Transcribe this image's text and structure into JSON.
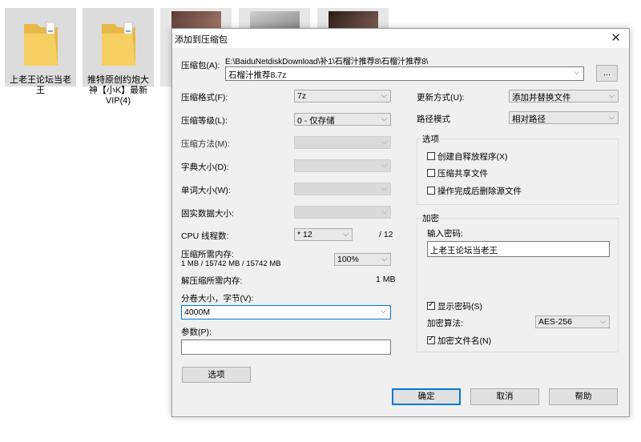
{
  "desktop": {
    "items": [
      {
        "label": "上老王论坛当老王",
        "icon": "folder-icon"
      },
      {
        "label": "推特原创约炮大神【小K】最新VIP(4)",
        "icon": "folder-icon"
      }
    ],
    "thumb_icons": [
      "image-thumbnail-icon",
      "image-thumbnail-icon",
      "image-thumbnail-icon"
    ]
  },
  "dialog": {
    "title": "添加到压缩包",
    "close_glyph": "✕",
    "archive": {
      "label": "压缩包(A):",
      "path": "E:\\BaiduNetdiskDownload\\补1\\石榴汁推荐8\\石榴汁推荐8\\",
      "value": "石榴汁推荐8.7z",
      "browse_label": "..."
    },
    "left": {
      "format": {
        "label": "压缩格式(F):",
        "value": "7z"
      },
      "level": {
        "label": "压缩等级(L):",
        "value": "0 - 仅存储"
      },
      "method": {
        "label": "压缩方法(M):",
        "value": ""
      },
      "dict": {
        "label": "字典大小(D):",
        "value": ""
      },
      "word": {
        "label": "单词大小(W):",
        "value": ""
      },
      "solid": {
        "label": "固实数据大小:",
        "value": ""
      },
      "cpu": {
        "label": "CPU 线程数:",
        "value": "* 12",
        "total": "/ 12"
      },
      "mem_comp": {
        "label": "压缩所需内存:",
        "detail": "1 MB / 15742 MB / 15742 MB",
        "value": "100%"
      },
      "mem_decomp": {
        "label": "解压缩所需内存:",
        "value": "1 MB"
      },
      "volume": {
        "label": "分卷大小，字节(V):",
        "value": "4000M"
      },
      "params": {
        "label": "参数(P):",
        "value": ""
      },
      "options_button": "选项"
    },
    "right": {
      "update": {
        "label": "更新方式(U):",
        "value": "添加并替换文件"
      },
      "path_mode": {
        "label": "路径模式",
        "value": "相对路径"
      },
      "options": {
        "title": "选项",
        "sfx": {
          "label": "创建自释放程序(X)",
          "checked": false
        },
        "shared": {
          "label": "压缩共享文件",
          "checked": false
        },
        "delete": {
          "label": "操作完成后删除源文件",
          "checked": false
        }
      },
      "encryption": {
        "title": "加密",
        "password_label": "输入密码:",
        "password_value": "上老王论坛当老王",
        "show_password": {
          "label": "显示密码(S)",
          "checked": true
        },
        "method_label": "加密算法:",
        "method_value": "AES-256",
        "encrypt_names": {
          "label": "加密文件名(N)",
          "checked": true
        }
      }
    },
    "buttons": {
      "ok": "确定",
      "cancel": "取消",
      "help": "帮助"
    },
    "check_glyph": "✓",
    "arrow_glyph": "⌵"
  }
}
